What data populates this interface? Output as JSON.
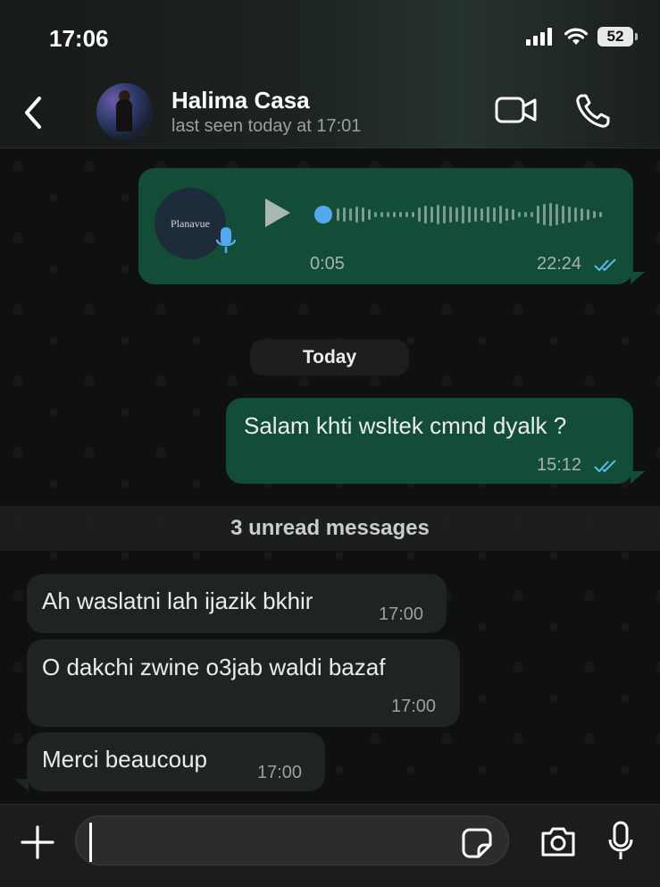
{
  "status_bar": {
    "time": "17:06",
    "battery": "52"
  },
  "header": {
    "contact_name": "Halima Casa",
    "last_seen": "last seen today at 17:01",
    "icons": [
      "back-chevron-icon",
      "video-call-icon",
      "phone-icon"
    ]
  },
  "messages_before": [
    {
      "type": "voice",
      "direction": "outgoing",
      "thumbnail_label": "Planavue",
      "duration": "0:05",
      "time": "22:24",
      "status": "read"
    }
  ],
  "date_separator": "Today",
  "messages_today": [
    {
      "direction": "outgoing",
      "text": "Salam khti wsltek cmnd dyalk ?",
      "time": "15:12",
      "status": "read"
    }
  ],
  "unread_banner": "3 unread messages",
  "messages_unread": [
    {
      "direction": "incoming",
      "text": "Ah waslatni lah ijazik bkhir",
      "time": "17:00"
    },
    {
      "direction": "incoming",
      "text": "O dakchi zwine o3jab waldi bazaf",
      "time": "17:00"
    },
    {
      "direction": "incoming",
      "text": "Merci beaucoup",
      "time": "17:00"
    }
  ],
  "composer": {
    "input_value": "",
    "icons": [
      "plus-icon",
      "sticker-icon",
      "camera-icon",
      "microphone-icon"
    ]
  },
  "colors": {
    "outgoing_bubble": "#144d37",
    "incoming_bubble": "#1f2321",
    "read_ticks": "#53bdeb",
    "voice_progress": "#53a8f0"
  }
}
